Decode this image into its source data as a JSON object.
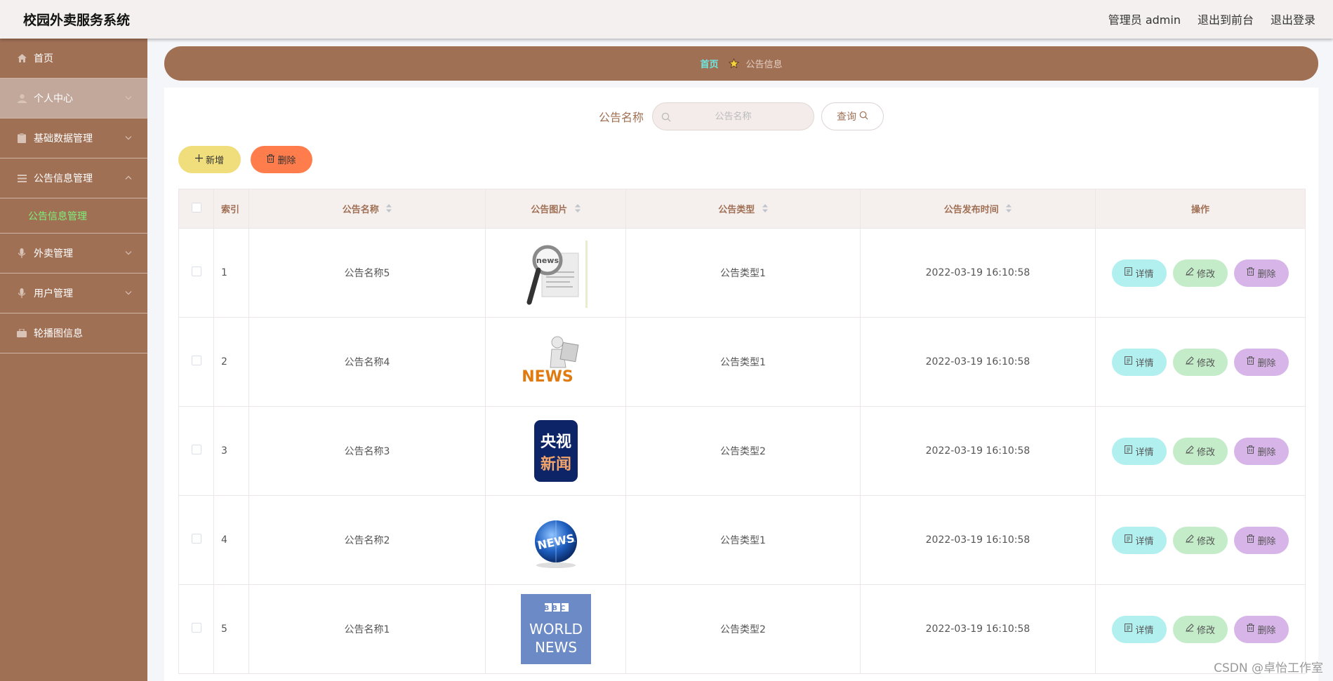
{
  "app": {
    "title": "校园外卖服务系统"
  },
  "header": {
    "admin_label": "管理员 admin",
    "front_label": "退出到前台",
    "logout_label": "退出登录"
  },
  "sidebar": {
    "items": [
      {
        "label": "首页",
        "icon": "home-icon"
      },
      {
        "label": "个人中心",
        "icon": "user-icon"
      },
      {
        "label": "基础数据管理",
        "icon": "clipboard-icon"
      },
      {
        "label": "公告信息管理",
        "icon": "list-icon"
      },
      {
        "label": "外卖管理",
        "icon": "mic-icon"
      },
      {
        "label": "用户管理",
        "icon": "mic-icon"
      },
      {
        "label": "轮播图信息",
        "icon": "bag-icon"
      }
    ],
    "submenu_label": "公告信息管理"
  },
  "breadcrumb": {
    "home": "首页",
    "current": "公告信息"
  },
  "search": {
    "label": "公告名称",
    "placeholder": "公告名称",
    "query_label": "查询"
  },
  "actions": {
    "add_label": "新增",
    "delete_label": "删除"
  },
  "table": {
    "columns": {
      "index": "索引",
      "name": "公告名称",
      "image": "公告图片",
      "type": "公告类型",
      "time": "公告发布时间",
      "ops": "操作"
    },
    "rows": [
      {
        "index": "1",
        "name": "公告名称5",
        "type": "公告类型1",
        "time": "2022-03-19 16:10:58"
      },
      {
        "index": "2",
        "name": "公告名称4",
        "type": "公告类型1",
        "time": "2022-03-19 16:10:58"
      },
      {
        "index": "3",
        "name": "公告名称3",
        "type": "公告类型2",
        "time": "2022-03-19 16:10:58"
      },
      {
        "index": "4",
        "name": "公告名称2",
        "type": "公告类型1",
        "time": "2022-03-19 16:10:58"
      },
      {
        "index": "5",
        "name": "公告名称1",
        "type": "公告类型2",
        "time": "2022-03-19 16:10:58"
      }
    ],
    "op_labels": {
      "detail": "详情",
      "edit": "修改",
      "delete": "删除"
    }
  },
  "images": {
    "row1": {
      "text": "news"
    },
    "row2": {
      "text": "NEWS"
    },
    "row3": {
      "line1": "央视",
      "line2": "新闻"
    },
    "row4": {
      "text": "NEWS"
    },
    "row5": {
      "line1": "BBC",
      "line2": "WORLD",
      "line3": "NEWS"
    }
  },
  "watermark": "CSDN @卓怡工作室",
  "colors": {
    "brand": "#a07055",
    "accent_green": "#7ef07a",
    "crumb_home": "#6ee7e3"
  }
}
